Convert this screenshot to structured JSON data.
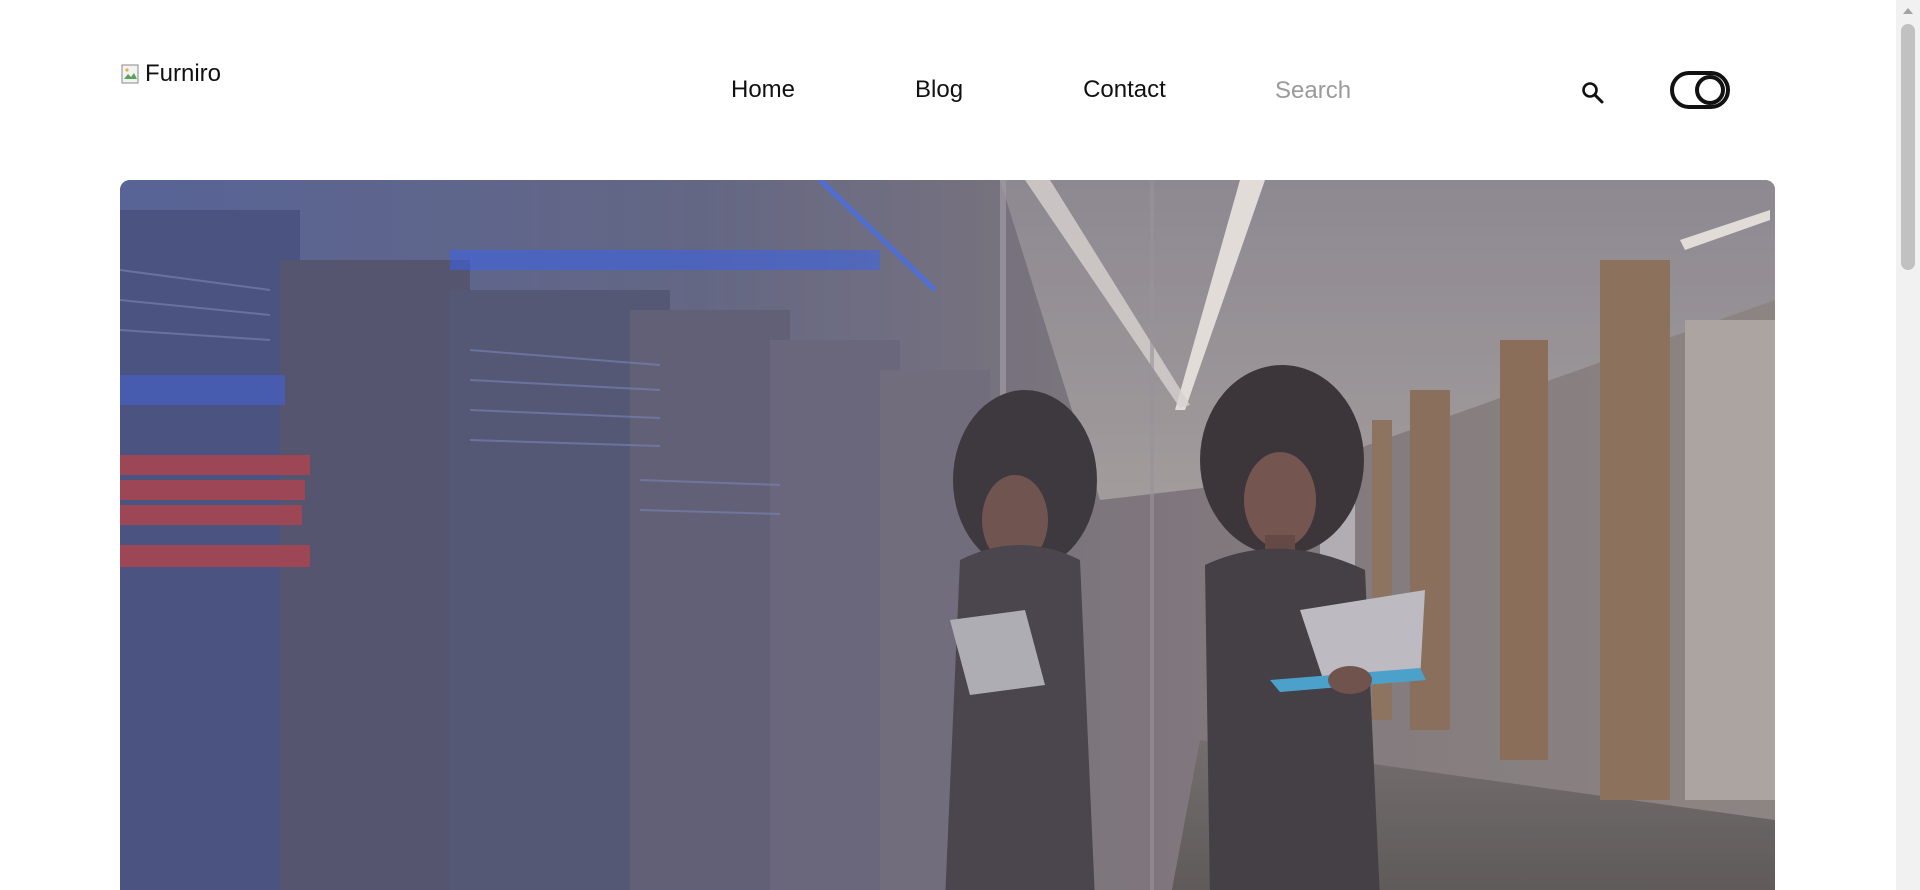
{
  "header": {
    "logo_alt": "Furniro",
    "nav": {
      "home": "Home",
      "blog": "Blog",
      "contact": "Contact"
    },
    "search": {
      "placeholder": "Search",
      "value": ""
    },
    "icons": {
      "search": "search-icon",
      "theme_toggle": "theme-toggle-icon",
      "logo": "broken-image-icon"
    }
  },
  "hero": {
    "image_alt": "",
    "colors": {
      "overlay": "#6b6770",
      "accent_blue": "#2a5cff"
    }
  }
}
